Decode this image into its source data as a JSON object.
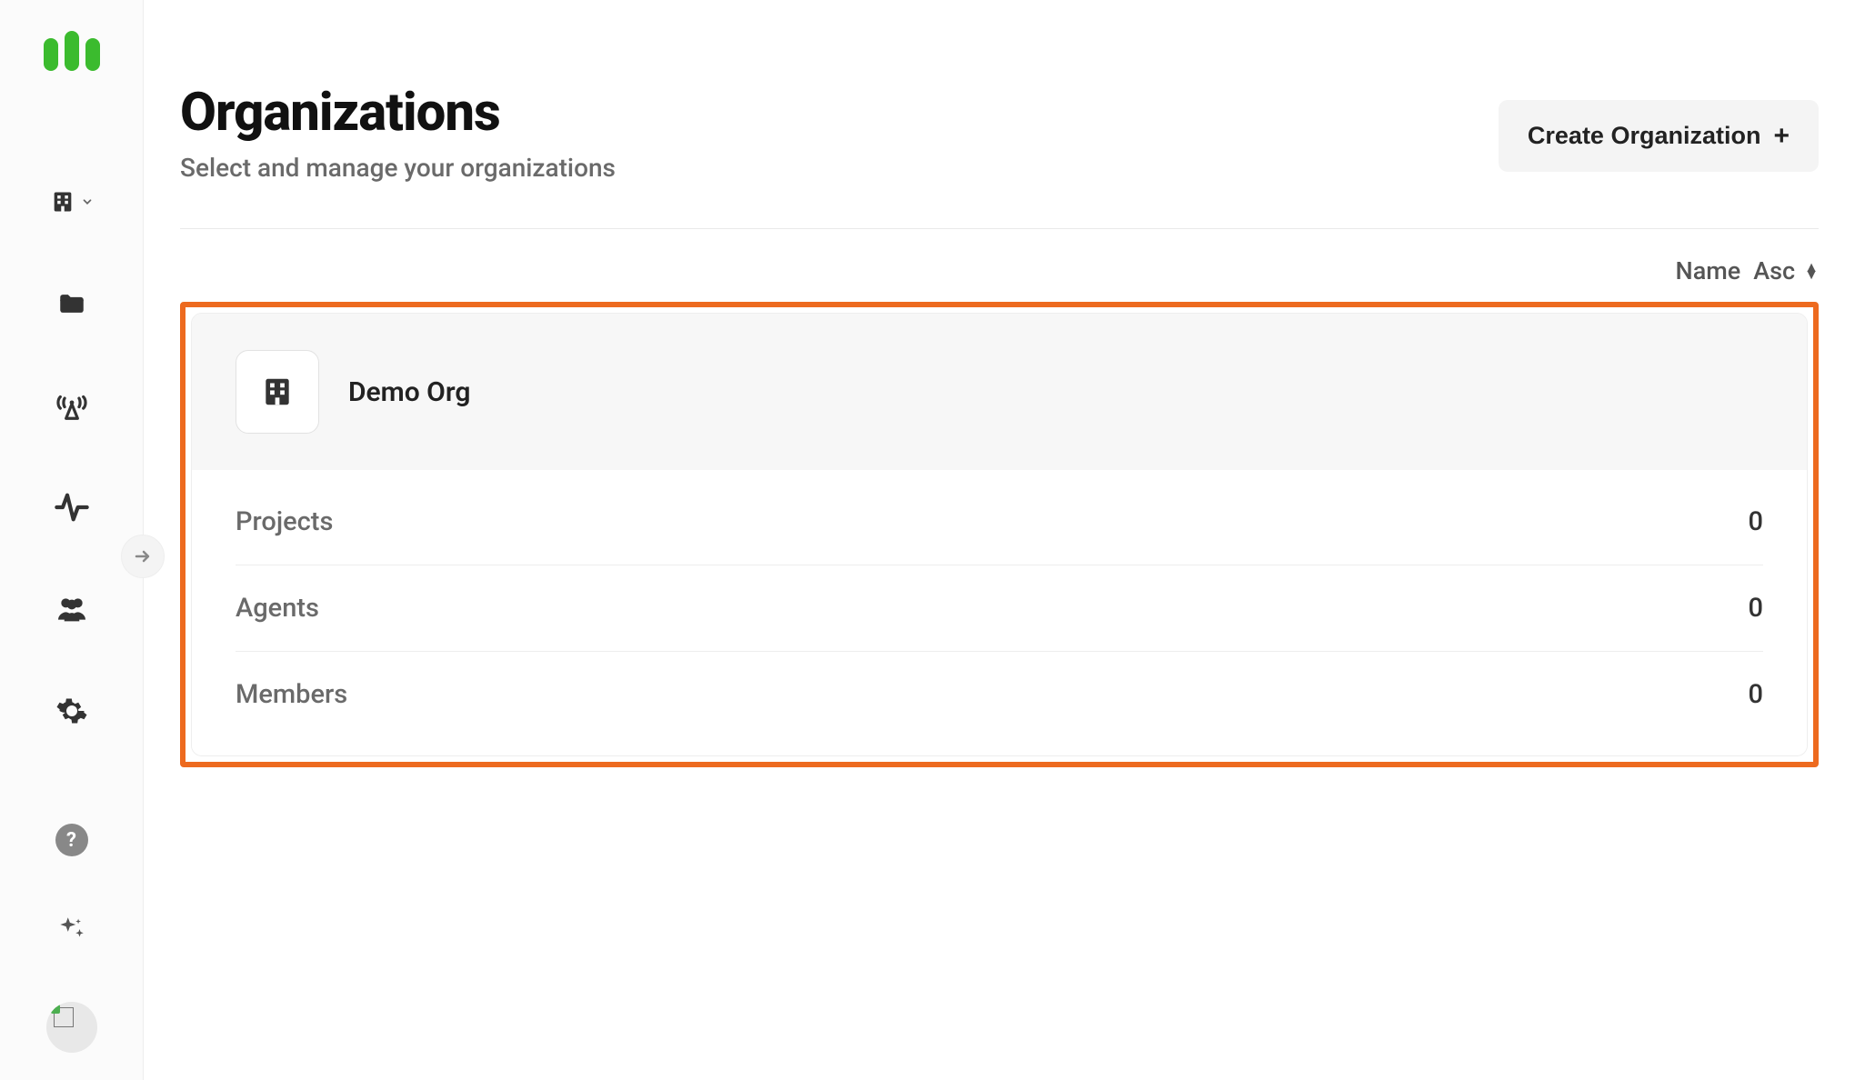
{
  "header": {
    "title": "Organizations",
    "subtitle": "Select and manage your organizations",
    "create_button_label": "Create Organization"
  },
  "sort": {
    "field_label": "Name",
    "direction_label": "Asc"
  },
  "organization": {
    "name": "Demo Org",
    "stats": [
      {
        "label": "Projects",
        "value": "0"
      },
      {
        "label": "Agents",
        "value": "0"
      },
      {
        "label": "Members",
        "value": "0"
      }
    ]
  },
  "sidebar": {
    "help_label": "?"
  }
}
